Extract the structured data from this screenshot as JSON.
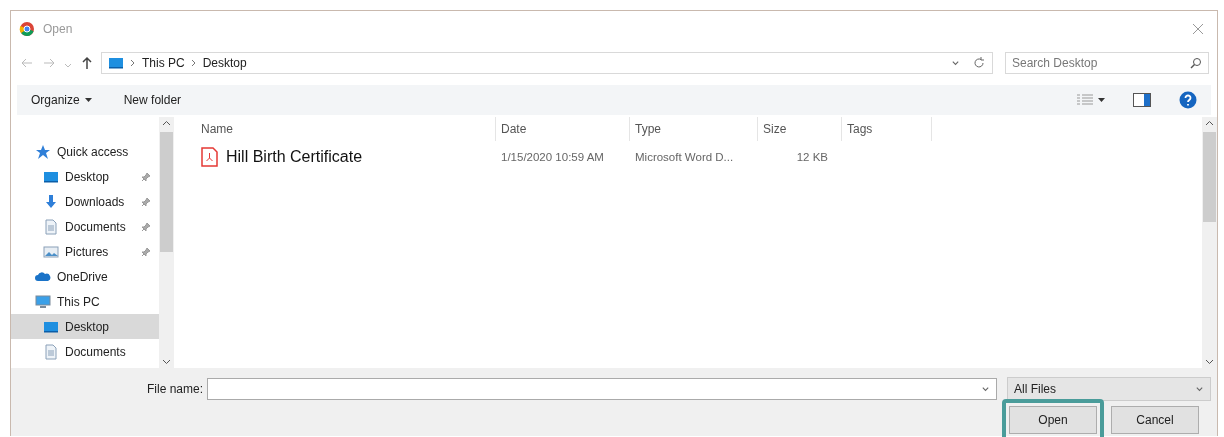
{
  "window": {
    "title": "Open"
  },
  "breadcrumb": [
    "This PC",
    "Desktop"
  ],
  "search": {
    "placeholder": "Search Desktop"
  },
  "toolbar": {
    "organize": "Organize",
    "new_folder": "New folder"
  },
  "sidebar": [
    {
      "label": "Quick access",
      "kind": "star",
      "selected": false,
      "children": [
        {
          "label": "Desktop",
          "kind": "desktop",
          "pinned": true,
          "selected": false
        },
        {
          "label": "Downloads",
          "kind": "download",
          "pinned": true,
          "selected": false
        },
        {
          "label": "Documents",
          "kind": "document",
          "pinned": true,
          "selected": false
        },
        {
          "label": "Pictures",
          "kind": "pictures",
          "pinned": true,
          "selected": false
        }
      ]
    },
    {
      "label": "OneDrive",
      "kind": "cloud",
      "selected": false
    },
    {
      "label": "This PC",
      "kind": "pc",
      "selected": false,
      "children": [
        {
          "label": "Desktop",
          "kind": "desktop",
          "pinned": false,
          "selected": true
        },
        {
          "label": "Documents",
          "kind": "document",
          "pinned": false,
          "selected": false
        }
      ]
    }
  ],
  "table": {
    "columns": [
      "Name",
      "Date",
      "Type",
      "Size",
      "Tags"
    ],
    "rows": [
      {
        "name": "Hill Birth Certificate",
        "date": "1/15/2020 10:59 AM",
        "type": "Microsoft Word D...",
        "size": "12 KB"
      }
    ]
  },
  "file_name": {
    "label": "File name:"
  },
  "file_type": "All Files",
  "buttons": [
    {
      "label": "Open",
      "highlighted": true
    },
    {
      "label": "Cancel",
      "highlighted": false
    }
  ]
}
